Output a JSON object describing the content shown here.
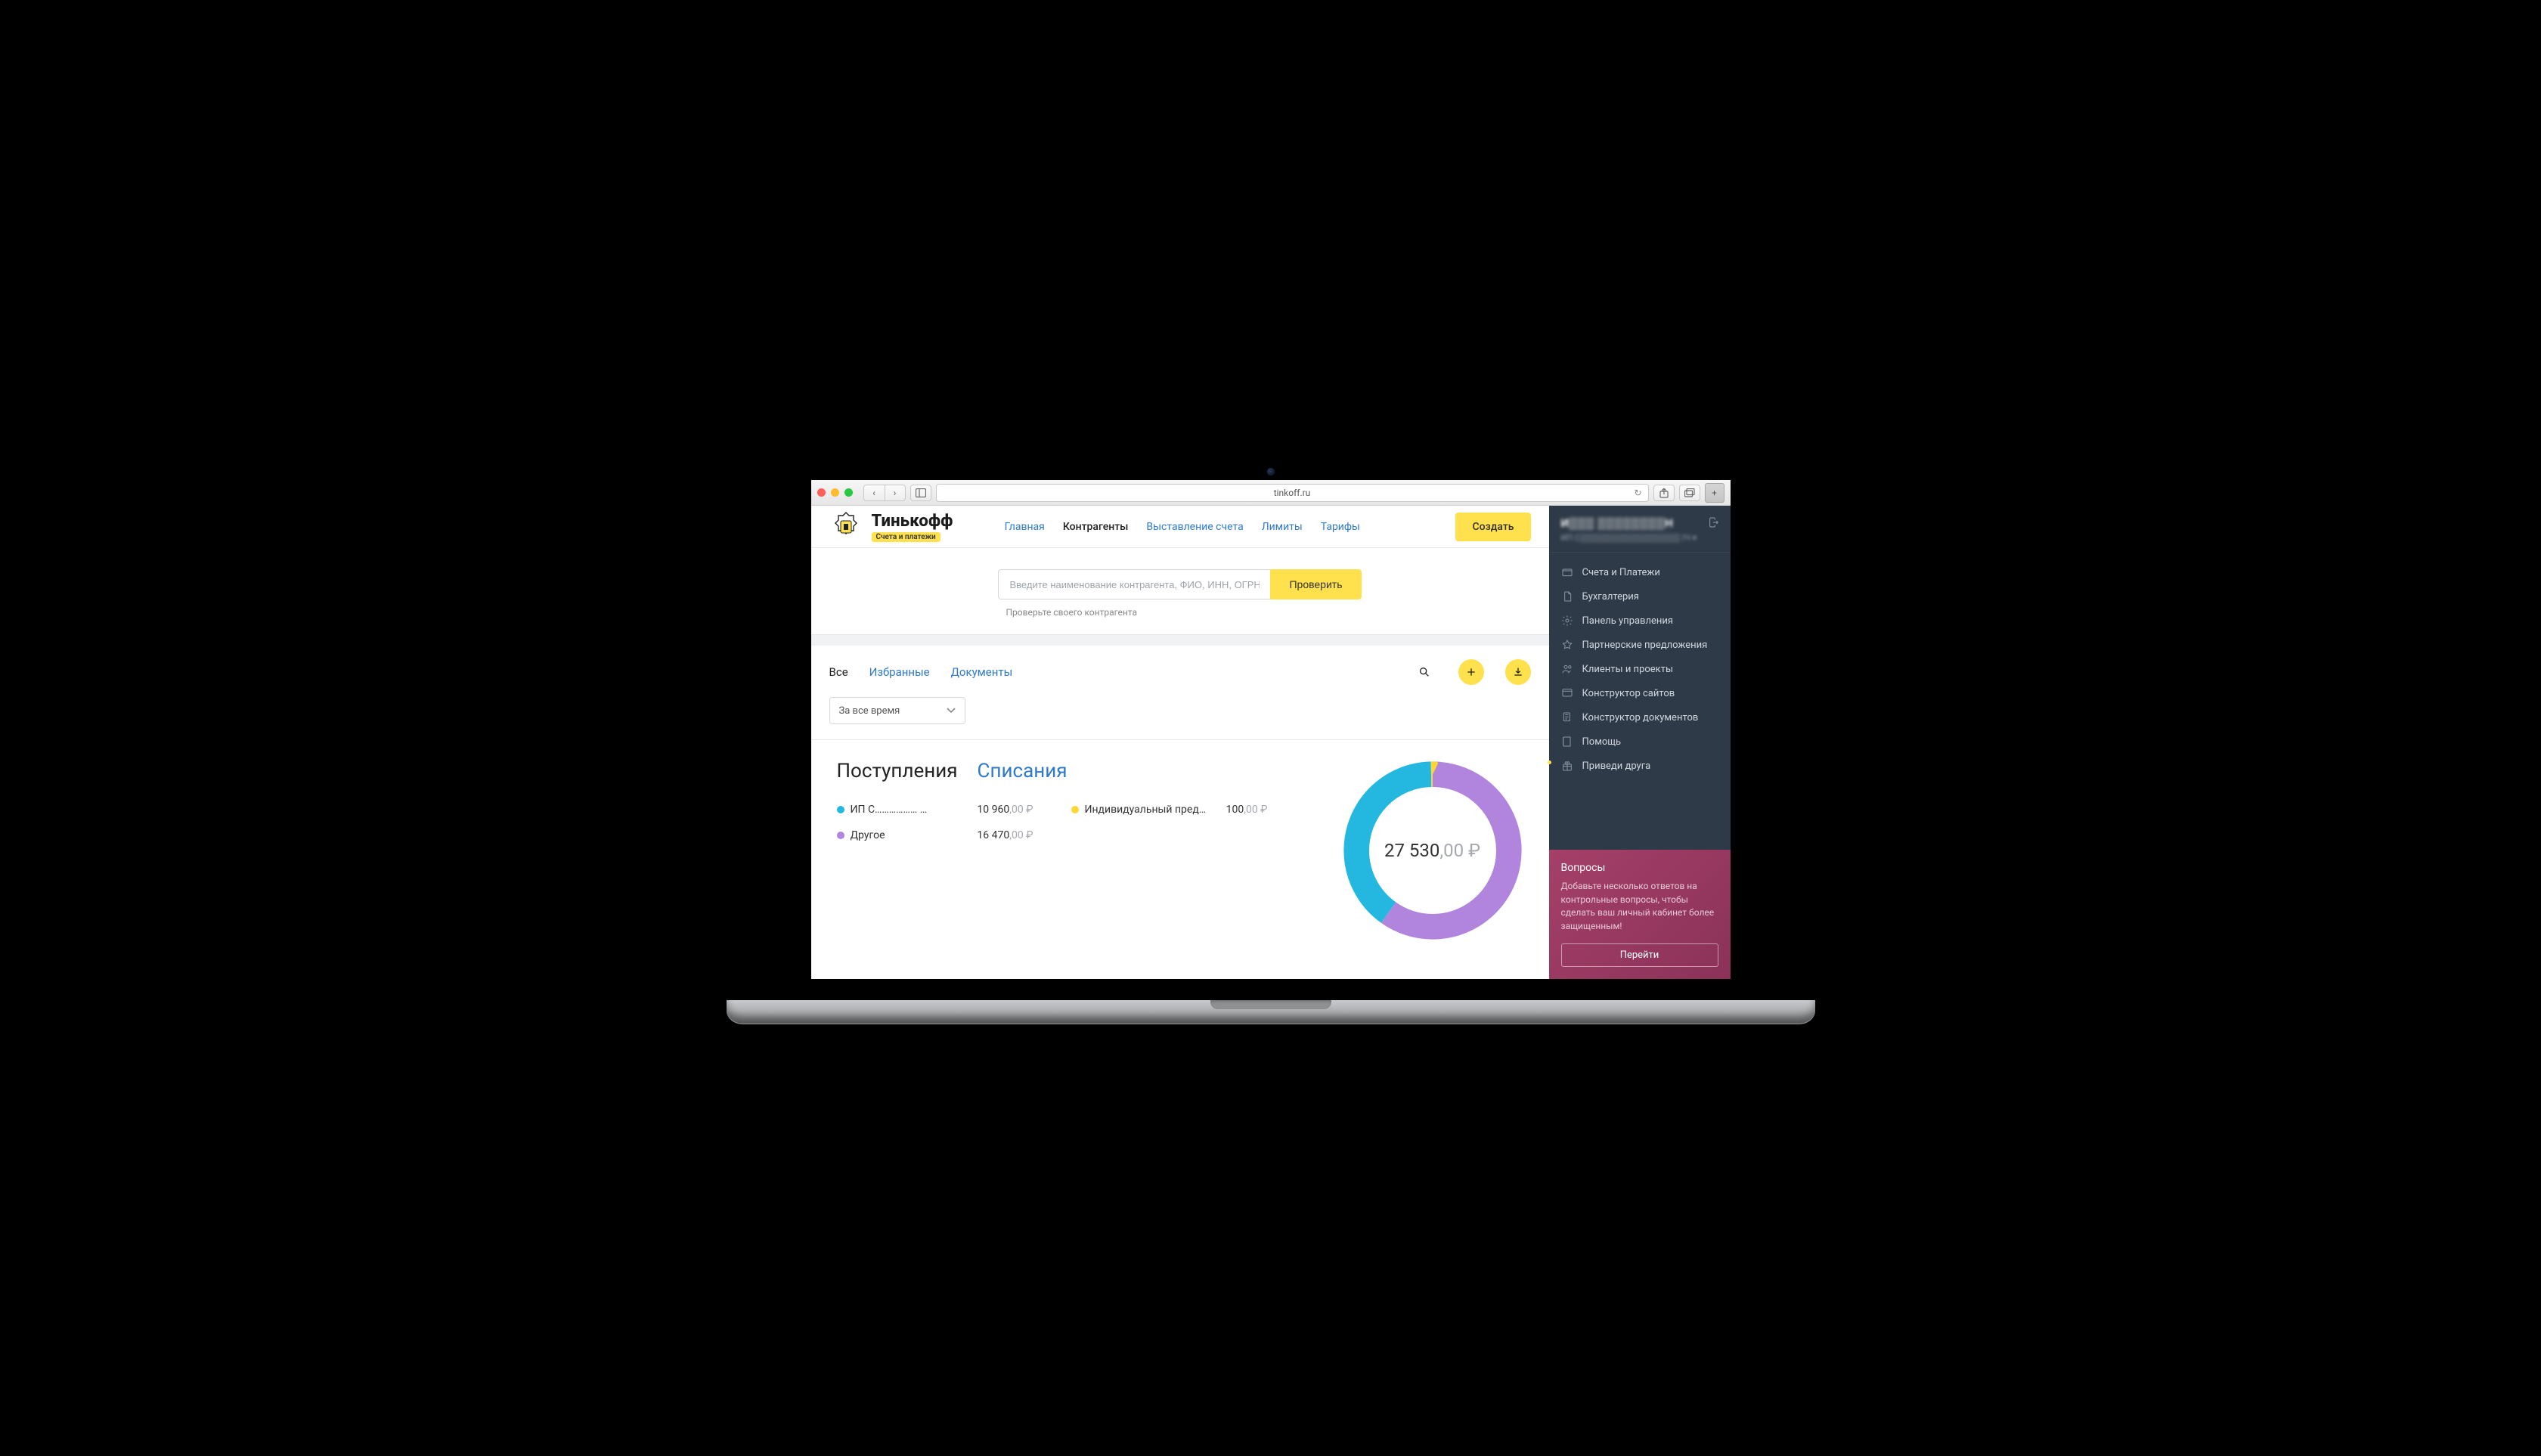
{
  "browser": {
    "url": "tinkoff.ru"
  },
  "brand": {
    "title": "Тинькофф",
    "tagline": "Счета и платежи"
  },
  "nav": {
    "items": [
      {
        "label": "Главная"
      },
      {
        "label": "Контрагенты",
        "active": true
      },
      {
        "label": "Выставление счета"
      },
      {
        "label": "Лимиты"
      },
      {
        "label": "Тарифы"
      }
    ],
    "create_label": "Создать"
  },
  "search": {
    "placeholder": "Введите наименование контрагента, ФИО, ИНН, ОГРН",
    "button": "Проверить",
    "hint": "Проверьте своего контрагента"
  },
  "tabs": {
    "items": [
      {
        "label": "Все",
        "active": true
      },
      {
        "label": "Избранные"
      },
      {
        "label": "Документы"
      }
    ]
  },
  "filter": {
    "period": "За все время"
  },
  "stats": {
    "tabs": {
      "incoming": "Поступления",
      "outgoing": "Списания"
    },
    "total_int": "27 530",
    "total_frac": ",00",
    "currency": " ₽",
    "legend": [
      {
        "color": "#24b8e0",
        "label": "ИП С……………… …",
        "int": "10 960",
        "frac": ",00"
      },
      {
        "color": "#ffd633",
        "label": "Индивидуальный пред…",
        "int": "100",
        "frac": ",00"
      },
      {
        "color": "#b185dd",
        "label": "Другое",
        "int": "16 470",
        "frac": ",00"
      }
    ]
  },
  "sidebar": {
    "user_name_hidden": "И▒▒▒ ▒▒▒▒▒▒▒▒Н",
    "user_sub_hidden": "ИП С▒▒▒▒▒▒▒▒▒▒▒▒▒▒▒▒▒ IЧ ▾",
    "items": [
      {
        "icon": "wallet",
        "label": "Счета и Платежи"
      },
      {
        "icon": "doc",
        "label": "Бухгалтерия"
      },
      {
        "icon": "gear",
        "label": "Панель управления"
      },
      {
        "icon": "star",
        "label": "Партнерские предложения"
      },
      {
        "icon": "users",
        "label": "Клиенты и проекты"
      },
      {
        "icon": "site",
        "label": "Конструктор сайтов"
      },
      {
        "icon": "docs",
        "label": "Конструктор документов"
      },
      {
        "icon": "book",
        "label": "Помощь"
      },
      {
        "icon": "gift",
        "label": "Приведи друга",
        "badge": true
      }
    ],
    "promo": {
      "title": "Вопросы",
      "text": "Добавьте несколько ответов на контрольные вопросы, чтобы сделать ваш личный кабинет более защищенным!",
      "button": "Перейти"
    }
  },
  "chart_data": {
    "type": "pie",
    "title": "Поступления",
    "series": [
      {
        "name": "ИП С…",
        "value": 10960,
        "color": "#24b8e0"
      },
      {
        "name": "Индивидуальный пред…",
        "value": 100,
        "color": "#ffd633"
      },
      {
        "name": "Другое",
        "value": 16470,
        "color": "#b185dd"
      }
    ],
    "total": 27530,
    "currency": "RUB"
  }
}
